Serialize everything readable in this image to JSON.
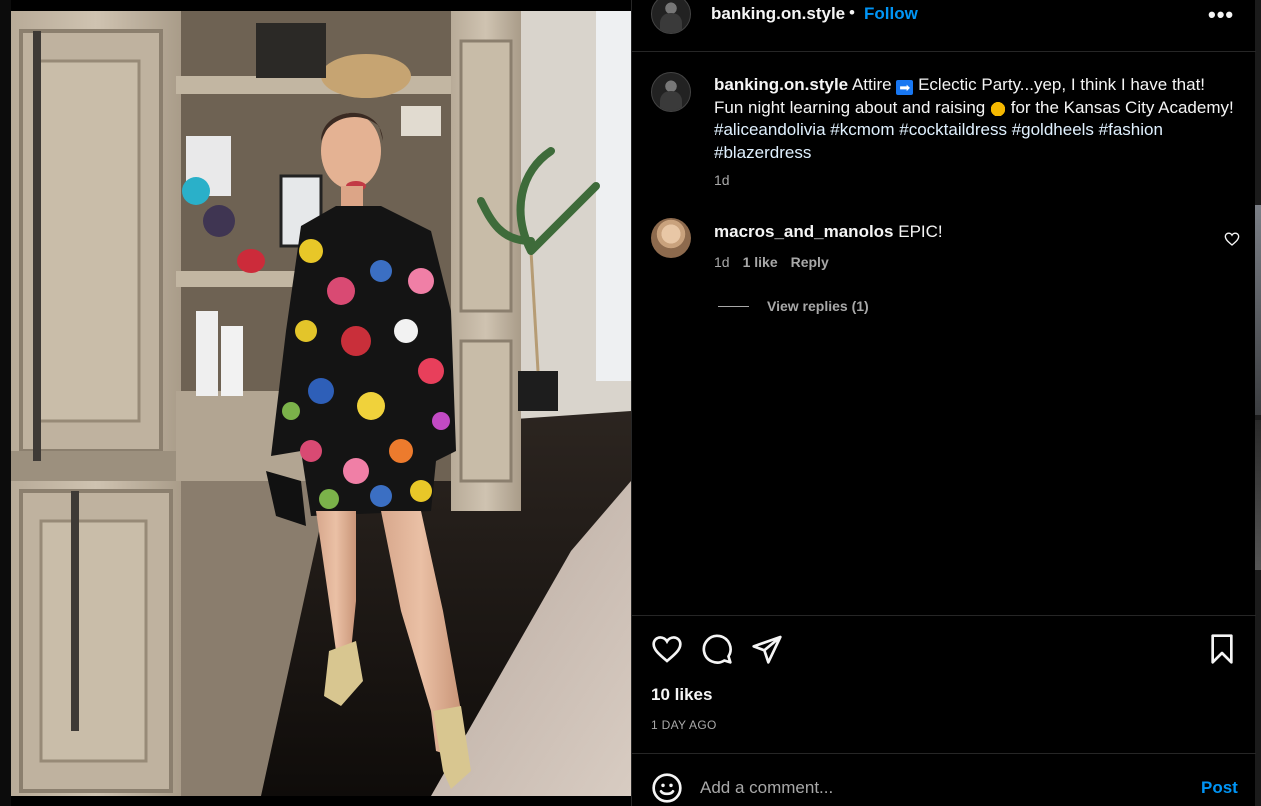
{
  "header": {
    "username": "banking.on.style",
    "separator": "•",
    "follow_label": "Follow",
    "more_icon": "more-horizontal-icon",
    "more_label": "•••"
  },
  "caption": {
    "username": "banking.on.style",
    "text_1": "Attire",
    "arrow_emoji": "➡",
    "text_2": "Eclectic Party...yep, I think I have that! Fun night learning about and raising",
    "money_emoji": "💰",
    "text_3": "for the Kansas City Academy!",
    "hashtags": [
      "#aliceandolivia",
      "#kcmom",
      "#cocktaildress",
      "#goldheels",
      "#fashion",
      "#blazerdress"
    ],
    "age": "1d"
  },
  "comments": [
    {
      "username": "macros_and_manolos",
      "text": "EPIC!",
      "age": "1d",
      "likes": "1 like",
      "reply_label": "Reply",
      "view_replies": "View replies (1)"
    }
  ],
  "actions": {
    "icons": [
      "heart-icon",
      "comment-icon",
      "share-icon",
      "bookmark-icon"
    ],
    "likes": "10 likes",
    "date": "1 DAY AGO"
  },
  "add_comment": {
    "placeholder": "Add a comment...",
    "post_label": "Post",
    "emoji_icon": "smiley-icon"
  },
  "colors": {
    "background": "#000000",
    "link_blue": "#0095f6",
    "secondary_text": "#a8a8a8",
    "divider": "#262626"
  }
}
